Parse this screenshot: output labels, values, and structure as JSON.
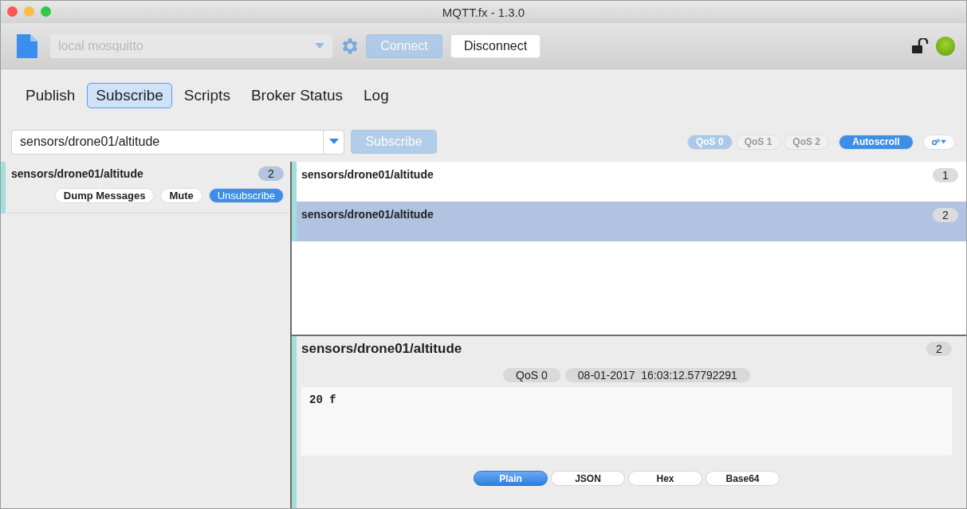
{
  "window": {
    "title": "MQTT.fx - 1.3.0"
  },
  "toolbar": {
    "profile": {
      "value": "local mosquitto",
      "disabled": true
    },
    "connect": {
      "label": "Connect",
      "disabled": true
    },
    "disconnect": {
      "label": "Disconnect",
      "disabled": false
    },
    "connected": true
  },
  "tabs": [
    {
      "label": "Publish",
      "selected": false
    },
    {
      "label": "Subscribe",
      "selected": true
    },
    {
      "label": "Scripts",
      "selected": false
    },
    {
      "label": "Broker Status",
      "selected": false
    },
    {
      "label": "Log",
      "selected": false
    }
  ],
  "subscribe_bar": {
    "topic": "sensors/drone01/altitude",
    "button": {
      "label": "Subscribe",
      "disabled": true
    },
    "qos": [
      {
        "label": "QoS 0",
        "selected": true
      },
      {
        "label": "QoS 1",
        "selected": false
      },
      {
        "label": "QoS 2",
        "selected": false
      }
    ],
    "autoscroll": {
      "label": "Autoscroll",
      "on": true
    }
  },
  "subscriptions": [
    {
      "topic": "sensors/drone01/altitude",
      "count": "2",
      "actions": [
        {
          "label": "Dump Messages",
          "kind": "plain"
        },
        {
          "label": "Mute",
          "kind": "plain"
        },
        {
          "label": "Unsubscribe",
          "kind": "primary"
        }
      ]
    }
  ],
  "messages": [
    {
      "topic": "sensors/drone01/altitude",
      "number": "1",
      "selected": false
    },
    {
      "topic": "sensors/drone01/altitude",
      "number": "2",
      "selected": true
    }
  ],
  "detail": {
    "topic": "sensors/drone01/altitude",
    "number": "2",
    "qos": "QoS 0",
    "timestamp": "08-01-2017  16:03:12.57792291",
    "payload": "20 f",
    "formats": [
      {
        "label": "Plain",
        "selected": true
      },
      {
        "label": "JSON",
        "selected": false
      },
      {
        "label": "Hex",
        "selected": false
      },
      {
        "label": "Base64",
        "selected": false
      }
    ]
  }
}
